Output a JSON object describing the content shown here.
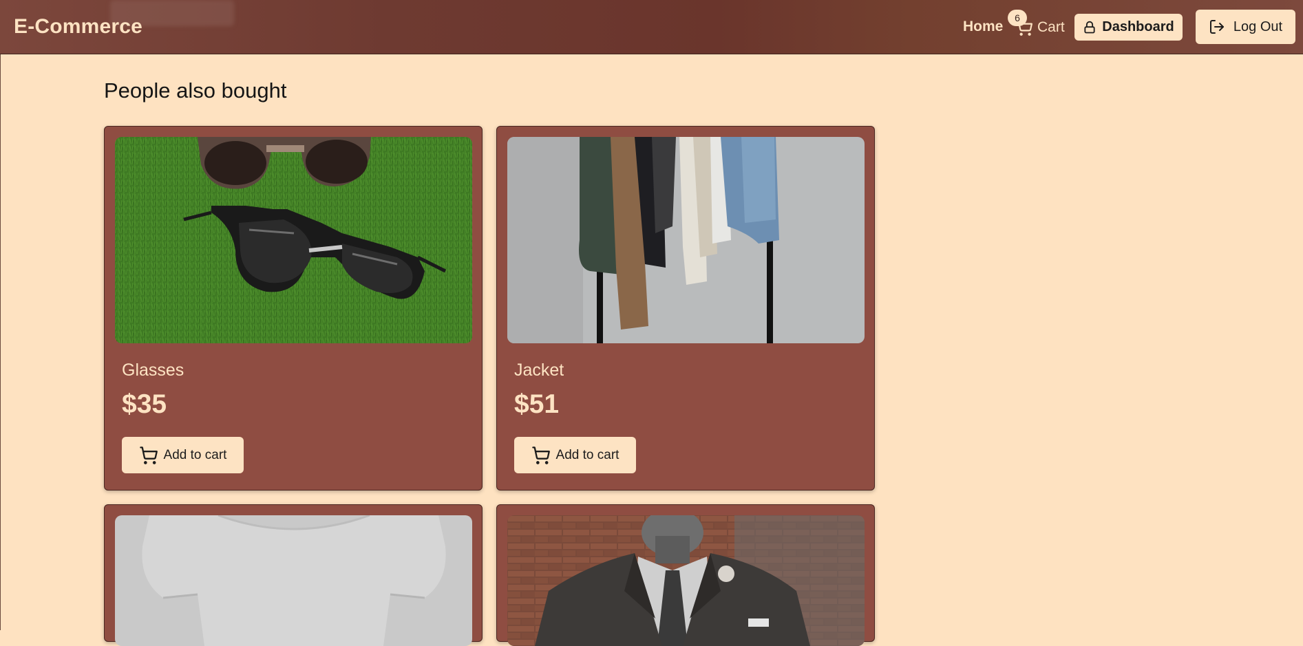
{
  "header": {
    "brand": "E-Commerce",
    "nav_home": "Home",
    "nav_cart": "Cart",
    "cart_count": "6",
    "dashboard_label": "Dashboard",
    "logout_label": "Log Out"
  },
  "section": {
    "title": "People also bought"
  },
  "products": [
    {
      "name": "Glasses",
      "price": "$35",
      "button": "Add to cart",
      "image": "sunglasses-on-grass"
    },
    {
      "name": "Jacket",
      "price": "$51",
      "button": "Add to cart",
      "image": "jackets-on-rack"
    },
    {
      "name": "",
      "price": "",
      "button": "",
      "image": "white-tshirt"
    },
    {
      "name": "",
      "price": "",
      "button": "",
      "image": "suit-on-mannequin"
    }
  ],
  "colors": {
    "background": "#fee2c1",
    "header": "#6e3a31",
    "card": "#8f4d42",
    "accent_light": "#fde3c3"
  }
}
